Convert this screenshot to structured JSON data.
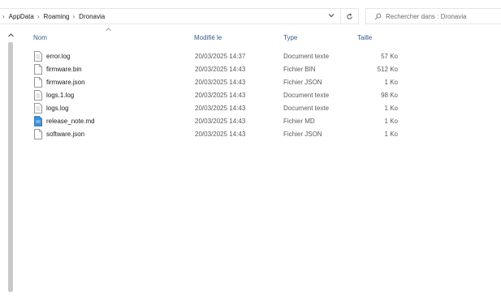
{
  "breadcrumb": {
    "items": [
      "AppData",
      "Roaming",
      "Dronavia"
    ]
  },
  "search": {
    "placeholder": "Rechercher dans : Dronavia"
  },
  "columns": {
    "name": "Nom",
    "modified": "Modifié le",
    "type": "Type",
    "size": "Taille"
  },
  "files": [
    {
      "name": "error.log",
      "modified": "20/03/2025 14:37",
      "type": "Document texte",
      "size": "57 Ko",
      "icon": "document-icon"
    },
    {
      "name": "firmware.bin",
      "modified": "20/03/2025 14:43",
      "type": "Fichier BIN",
      "size": "512 Ko",
      "icon": "file-icon"
    },
    {
      "name": "firmware.json",
      "modified": "20/03/2025 14:43",
      "type": "Fichier JSON",
      "size": "1 Ko",
      "icon": "file-icon"
    },
    {
      "name": "logs.1.log",
      "modified": "20/03/2025 14:43",
      "type": "Document texte",
      "size": "98 Ko",
      "icon": "document-icon"
    },
    {
      "name": "logs.log",
      "modified": "20/03/2025 14:43",
      "type": "Document texte",
      "size": "1 Ko",
      "icon": "document-icon"
    },
    {
      "name": "release_note.md",
      "modified": "20/03/2025 14:43",
      "type": "Fichier MD",
      "size": "1 Ko",
      "icon": "markdown-icon"
    },
    {
      "name": "software.json",
      "modified": "20/03/2025 14:43",
      "type": "Fichier JSON",
      "size": "1 Ko",
      "icon": "file-icon"
    }
  ],
  "colors": {
    "header_text": "#3a5a8c",
    "border": "#e6e6e6",
    "scrollbar": "#c8c8c8",
    "md_icon": "#3b8fd9"
  }
}
